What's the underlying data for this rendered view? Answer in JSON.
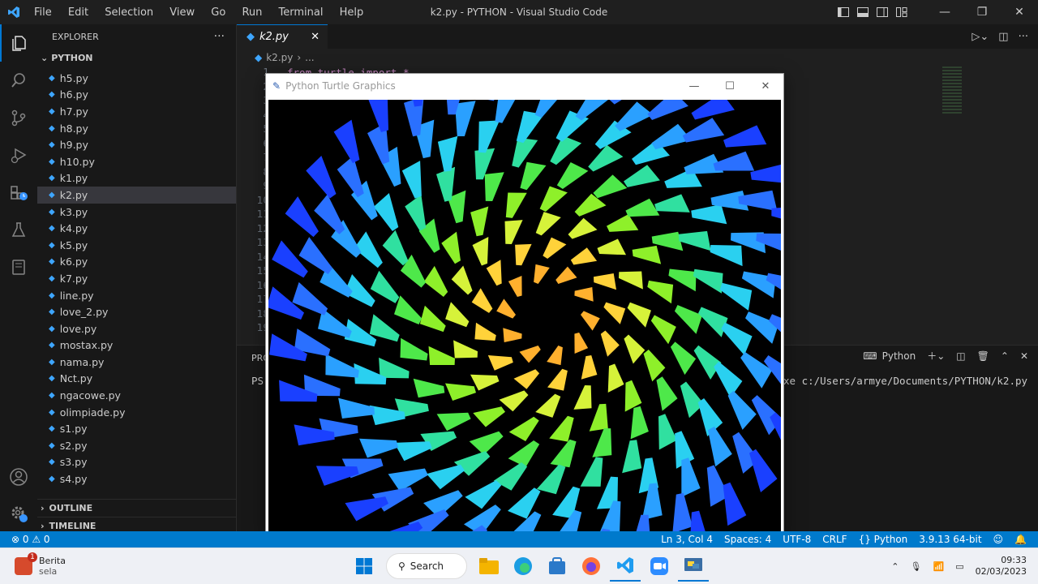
{
  "menu": [
    "File",
    "Edit",
    "Selection",
    "View",
    "Go",
    "Run",
    "Terminal",
    "Help"
  ],
  "window_title": "k2.py - PYTHON - Visual Studio Code",
  "explorer": {
    "header": "EXPLORER",
    "more": "···",
    "folder": "PYTHON",
    "files": [
      "h5.py",
      "h6.py",
      "h7.py",
      "h8.py",
      "h9.py",
      "h10.py",
      "k1.py",
      "k2.py",
      "k3.py",
      "k4.py",
      "k5.py",
      "k6.py",
      "k7.py",
      "line.py",
      "love_2.py",
      "love.py",
      "mostax.py",
      "nama.py",
      "Nct.py",
      "ngacowe.py",
      "olimpiade.py",
      "s1.py",
      "s2.py",
      "s3.py",
      "s4.py"
    ],
    "selected": "k2.py",
    "outline": "OUTLINE",
    "timeline": "TIMELINE"
  },
  "editor": {
    "tab": "k2.py",
    "breadcrumb_file": "k2.py",
    "breadcrumb_more": "...",
    "code_line1": "from turtle import *",
    "line_numbers": [
      "1",
      "2",
      "3",
      "4",
      "5",
      "6",
      "7",
      "8",
      "9",
      "10",
      "11",
      "12",
      "13",
      "14",
      "15",
      "16",
      "17",
      "18",
      "19"
    ]
  },
  "panel": {
    "label": "PRO",
    "prompt": "PS",
    "command_tail": "xe c:/Users/armye/Documents/PYTHON/k2.py",
    "terminal_name": "Python"
  },
  "turtle_window": {
    "title": "Python Turtle Graphics"
  },
  "status": {
    "problems": "⊗ 0 ⚠ 0",
    "position": "Ln 3, Col 4",
    "spaces": "Spaces: 4",
    "encoding": "UTF-8",
    "eol": "CRLF",
    "language": "{} Python",
    "interpreter": "3.9.13 64-bit"
  },
  "taskbar": {
    "news_title": "Berita",
    "news_sub": "sela",
    "news_badge": "1",
    "search": "Search",
    "time": "09:33",
    "date": "02/03/2023"
  },
  "colors": {
    "accent": "#007acc",
    "vscode_blue": "#0078d4"
  }
}
